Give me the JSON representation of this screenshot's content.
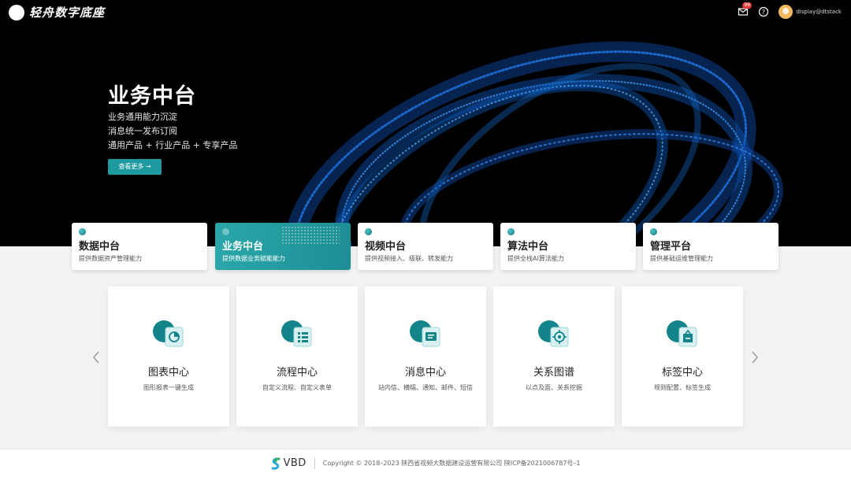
{
  "app": {
    "logo_text": "轻舟数字底座",
    "mail_badge": "99",
    "user": "display@dtstack"
  },
  "hero": {
    "title": "业务中台",
    "lines": [
      "业务通用能力沉淀",
      "消息统一发布订阅",
      "通用产品 + 行业产品 + 专享产品"
    ],
    "button": "查看更多 →"
  },
  "platforms": [
    {
      "title": "数据中台",
      "desc": "提供数据资产管理能力",
      "active": false
    },
    {
      "title": "业务中台",
      "desc": "提供数据业务赋能能力",
      "active": true
    },
    {
      "title": "视频中台",
      "desc": "提供视频接入、级联、转发能力",
      "active": false
    },
    {
      "title": "算法中台",
      "desc": "提供全栈AI算法能力",
      "active": false
    },
    {
      "title": "管理平台",
      "desc": "提供基础运维管理能力",
      "active": false
    }
  ],
  "centers": [
    {
      "title": "图表中心",
      "desc": "图形报表一键生成",
      "icon": "chart-icon"
    },
    {
      "title": "流程中心",
      "desc": "自定义流程、自定义表单",
      "icon": "flow-icon"
    },
    {
      "title": "消息中心",
      "desc": "站内信、横幅、通知、邮件、短信",
      "icon": "message-icon"
    },
    {
      "title": "关系图谱",
      "desc": "以点及面、关系挖掘",
      "icon": "graph-icon"
    },
    {
      "title": "标签中心",
      "desc": "规则配置、标签生成",
      "icon": "tag-icon"
    }
  ],
  "footer": {
    "brand": "VBD",
    "copyright": "Copyright ©  2018–2023 陕西省视频大数据建设运营有限公司   陕ICP备2021006787号–1"
  },
  "colors": {
    "accent": "#1f9aa0",
    "hero_bg": "#000000",
    "ring": "#1565c0"
  }
}
